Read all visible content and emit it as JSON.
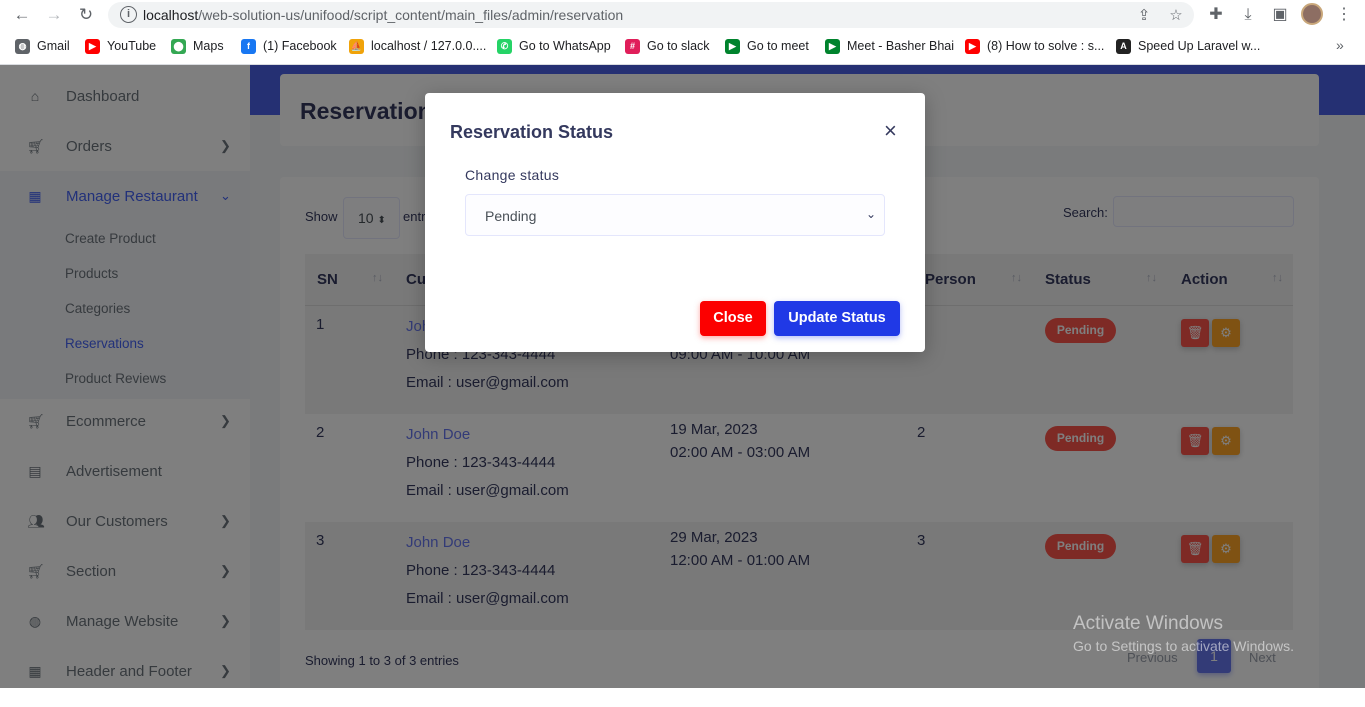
{
  "browser": {
    "url_host": "localhost",
    "url_path": "/web-solution-us/unifood/script_content/main_files/admin/reservation",
    "bookmarks": [
      {
        "label": "Gmail",
        "icon": "globe-icon",
        "color": "#5f6368"
      },
      {
        "label": "YouTube",
        "icon": "youtube-icon",
        "color": "#ff0000"
      },
      {
        "label": "Maps",
        "icon": "maps-icon",
        "color": "#34a853"
      },
      {
        "label": "(1) Facebook",
        "icon": "facebook-icon",
        "color": "#1877f2"
      },
      {
        "label": "localhost / 127.0.0....",
        "icon": "phpmyadmin-icon",
        "color": "#f0a30a"
      },
      {
        "label": "Go to WhatsApp",
        "icon": "whatsapp-icon",
        "color": "#25d366"
      },
      {
        "label": "Go to slack",
        "icon": "slack-icon",
        "color": "#e01e5a"
      },
      {
        "label": "Go to meet",
        "icon": "meet-icon",
        "color": "#00832d"
      },
      {
        "label": "Meet - Basher Bhai",
        "icon": "meet-icon",
        "color": "#00832d"
      },
      {
        "label": "(8) How to solve : s...",
        "icon": "youtube-icon",
        "color": "#ff0000"
      },
      {
        "label": "Speed Up Laravel w...",
        "icon": "laravel-icon",
        "color": "#222222"
      }
    ]
  },
  "sidebar": {
    "items": [
      {
        "label": "Dashboard",
        "icon": "fire-icon"
      },
      {
        "label": "Orders",
        "icon": "cart-icon"
      },
      {
        "label": "Manage Restaurant",
        "icon": "grid-icon"
      },
      {
        "label": "Ecommerce",
        "icon": "cart-icon"
      },
      {
        "label": "Advertisement",
        "icon": "ad-icon"
      },
      {
        "label": "Our Customers",
        "icon": "users-icon"
      },
      {
        "label": "Section",
        "icon": "cart-icon"
      },
      {
        "label": "Manage Website",
        "icon": "globe-icon"
      },
      {
        "label": "Header and Footer",
        "icon": "grid-icon"
      }
    ],
    "submenu": [
      "Create Product",
      "Products",
      "Categories",
      "Reservations",
      "Product Reviews"
    ]
  },
  "page": {
    "title": "Reservation",
    "show_label": "Show",
    "show_value": "10",
    "entries_label": "entries",
    "search_label": "Search:",
    "columns": [
      "SN",
      "Cu",
      "Person",
      "Status",
      "Action"
    ],
    "rows": [
      {
        "sn": "1",
        "name": "John Doe",
        "phone": "Phone : 123-343-4444",
        "email": "Email : user@gmail.com",
        "date": "",
        "time": "09:00 AM - 10:00 AM",
        "person": "2",
        "status": "Pending"
      },
      {
        "sn": "2",
        "name": "John Doe",
        "phone": "Phone : 123-343-4444",
        "email": "Email : user@gmail.com",
        "date": "19 Mar, 2023",
        "time": "02:00 AM - 03:00 AM",
        "person": "2",
        "status": "Pending"
      },
      {
        "sn": "3",
        "name": "John Doe",
        "phone": "Phone : 123-343-4444",
        "email": "Email : user@gmail.com",
        "date": "29 Mar, 2023",
        "time": "12:00 AM - 01:00 AM",
        "person": "3",
        "status": "Pending"
      }
    ],
    "footer_info": "Showing 1 to 3 of 3 entries",
    "pagination": {
      "prev": "Previous",
      "current": "1",
      "next": "Next"
    }
  },
  "modal": {
    "title": "Reservation Status",
    "close_symbol": "×",
    "field_label": "Change status",
    "selected_status": "Pending",
    "close_label": "Close",
    "update_label": "Update Status"
  },
  "watermark": {
    "line1": "Activate Windows",
    "line2": "Go to Settings to activate Windows."
  },
  "colors": {
    "primary": "#6777ef",
    "danger": "#fc544b",
    "warning": "#ffa426",
    "topband": "#4b60e6"
  }
}
